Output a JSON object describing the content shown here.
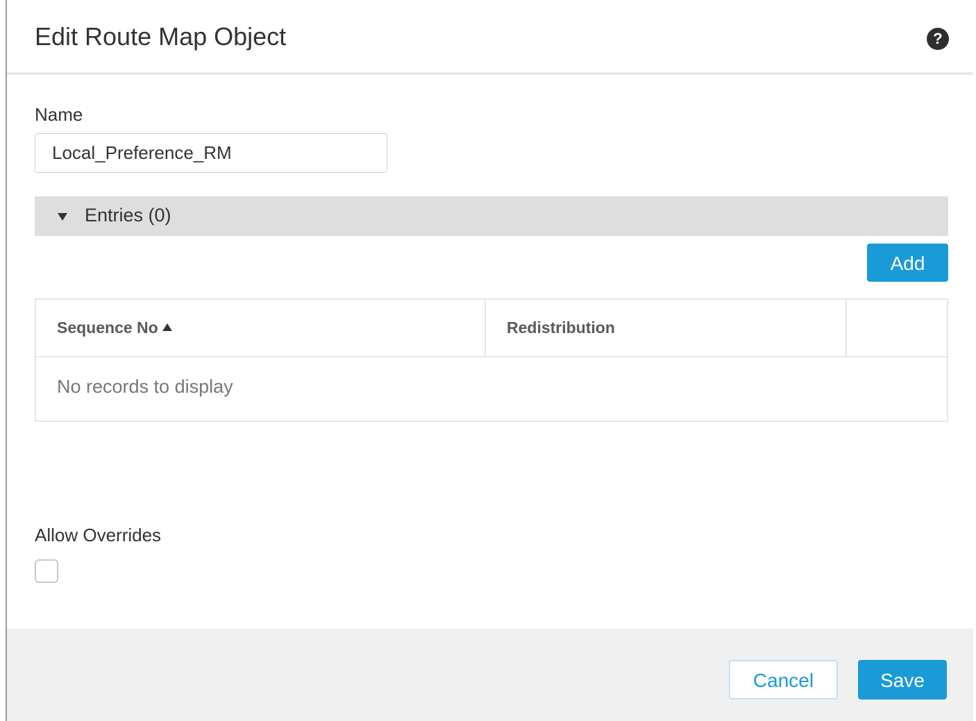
{
  "dialog": {
    "title": "Edit Route Map Object",
    "help_icon": "question-circle-icon"
  },
  "form": {
    "name_label": "Name",
    "name_value": "Local_Preference_RM",
    "entries_label": "Entries (0)",
    "add_label": "Add",
    "table": {
      "columns": [
        "Sequence No",
        "Redistribution",
        ""
      ],
      "sort_column": "Sequence No",
      "sort_direction": "ascending",
      "empty_message": "No records to display"
    },
    "overrides_label": "Allow Overrides",
    "overrides_checked": false
  },
  "footer": {
    "cancel_label": "Cancel",
    "save_label": "Save"
  },
  "colors": {
    "primary": "#1a9bd7",
    "header_bar": "#dedede",
    "footer_bg": "#f0f0f0"
  }
}
